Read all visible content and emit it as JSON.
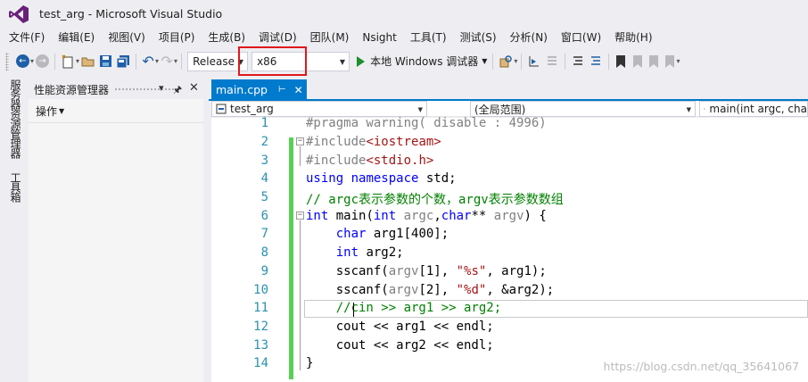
{
  "window": {
    "title": "test_arg - Microsoft Visual Studio"
  },
  "menu": [
    "文件(F)",
    "编辑(E)",
    "视图(V)",
    "项目(P)",
    "生成(B)",
    "调试(D)",
    "团队(M)",
    "Nsight",
    "工具(T)",
    "测试(S)",
    "分析(N)",
    "窗口(W)",
    "帮助(H)"
  ],
  "toolbar": {
    "configuration": "Release",
    "platform": "x86",
    "run_label": "本地 Windows 调试器"
  },
  "side_tabs": [
    "服务器资源管理器",
    "工具箱"
  ],
  "panel": {
    "title": "性能资源管理器",
    "action": "操作"
  },
  "editor": {
    "tab_name": "main.cpp",
    "nav_project": "test_arg",
    "nav_scope": "(全局范围)",
    "nav_function": "main(int argc, cha",
    "line_numbers": [
      "1",
      "2",
      "3",
      "4",
      "5",
      "6",
      "7",
      "8",
      "9",
      "10",
      "11",
      "12",
      "13",
      "14"
    ]
  },
  "watermark": "https://blog.csdn.net/qq_35641067",
  "colors": {
    "accent": "#007acc",
    "highlight_box": "#e0181d",
    "change_bar": "#57d053"
  }
}
